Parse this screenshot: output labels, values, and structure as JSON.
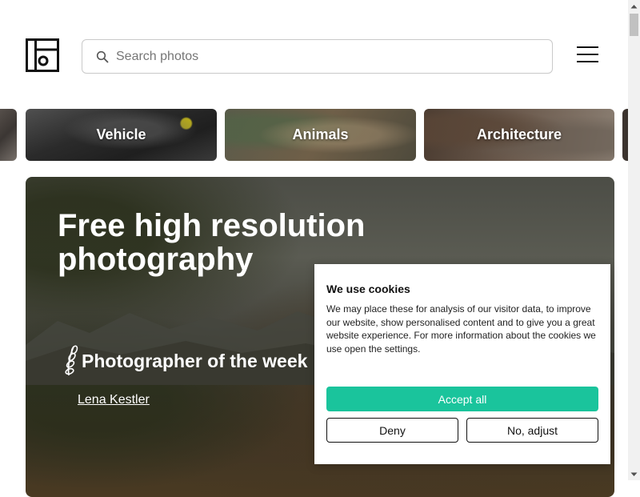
{
  "header": {
    "search_placeholder": "Search photos"
  },
  "categories": [
    {
      "label": ""
    },
    {
      "label": "Vehicle"
    },
    {
      "label": "Animals"
    },
    {
      "label": "Architecture"
    },
    {
      "label": ""
    }
  ],
  "hero": {
    "title_line1": "Free high resolution",
    "title_line2": "photography",
    "potw_title": "Photographer of the week",
    "photographer": "Lena Kestler"
  },
  "cookie": {
    "title": "We use cookies",
    "body": "We may place these for analysis of our visitor data, to improve our website, show personalised content and to give you a great website experience. For more information about the cookies we use open the settings.",
    "accept_label": "Accept all",
    "deny_label": "Deny",
    "adjust_label": "No, adjust"
  },
  "colors": {
    "accent": "#1ac49c"
  }
}
